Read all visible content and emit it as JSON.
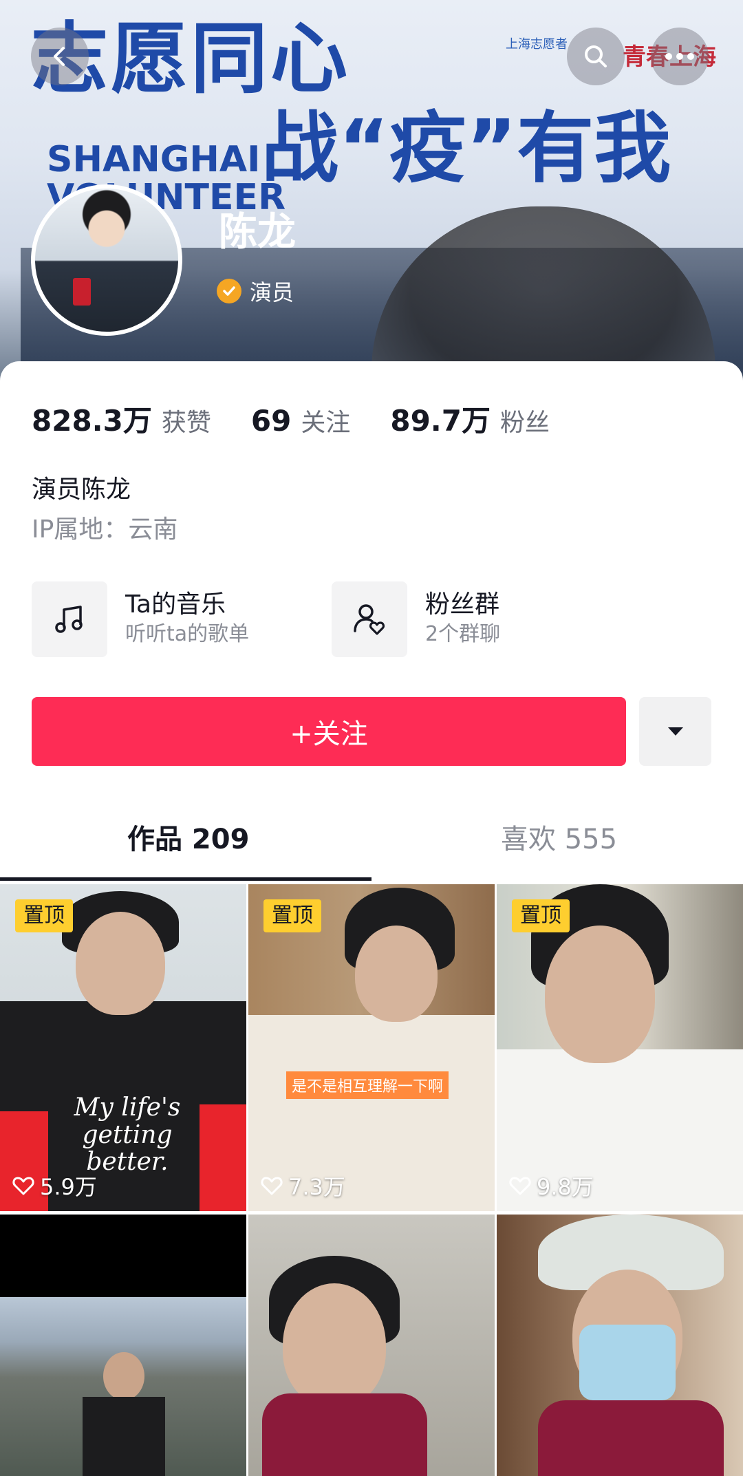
{
  "cover": {
    "banner_line1": "志愿同心",
    "banner_line2": "战“疫”有我",
    "banner_en": "SHANGHAI\nVOLUNTEER",
    "logo_text": "上海志愿者",
    "brand_text": "青春上海"
  },
  "profile": {
    "name": "陈龙",
    "verified_label": "演员",
    "bio": "演员陈龙",
    "ip_location": "IP属地：云南"
  },
  "stats": [
    {
      "num": "828.3万",
      "label": "获赞"
    },
    {
      "num": "69",
      "label": "关注"
    },
    {
      "num": "89.7万",
      "label": "粉丝"
    }
  ],
  "features": {
    "music": {
      "title": "Ta的音乐",
      "subtitle": "听听ta的歌单",
      "icon": "music-note-icon"
    },
    "fans": {
      "title": "粉丝群",
      "subtitle": "2个群聊",
      "icon": "fan-group-icon"
    }
  },
  "actions": {
    "follow": "+关注",
    "more_icon": "triangle-down-icon"
  },
  "tabs": {
    "works": "作品 209",
    "likes": "喜欢 555"
  },
  "videos": [
    {
      "pinned": "置顶",
      "likes": "5.9万"
    },
    {
      "pinned": "置顶",
      "likes": "7.3万",
      "caption": "是不是相互理解一下啊"
    },
    {
      "pinned": "置顶",
      "likes": "9.8万"
    },
    {},
    {},
    {}
  ],
  "video_text": {
    "shirt": "My life's getting better."
  },
  "colors": {
    "follow": "#fe2c55",
    "pin": "#fece2f",
    "verify": "#f5a623"
  }
}
